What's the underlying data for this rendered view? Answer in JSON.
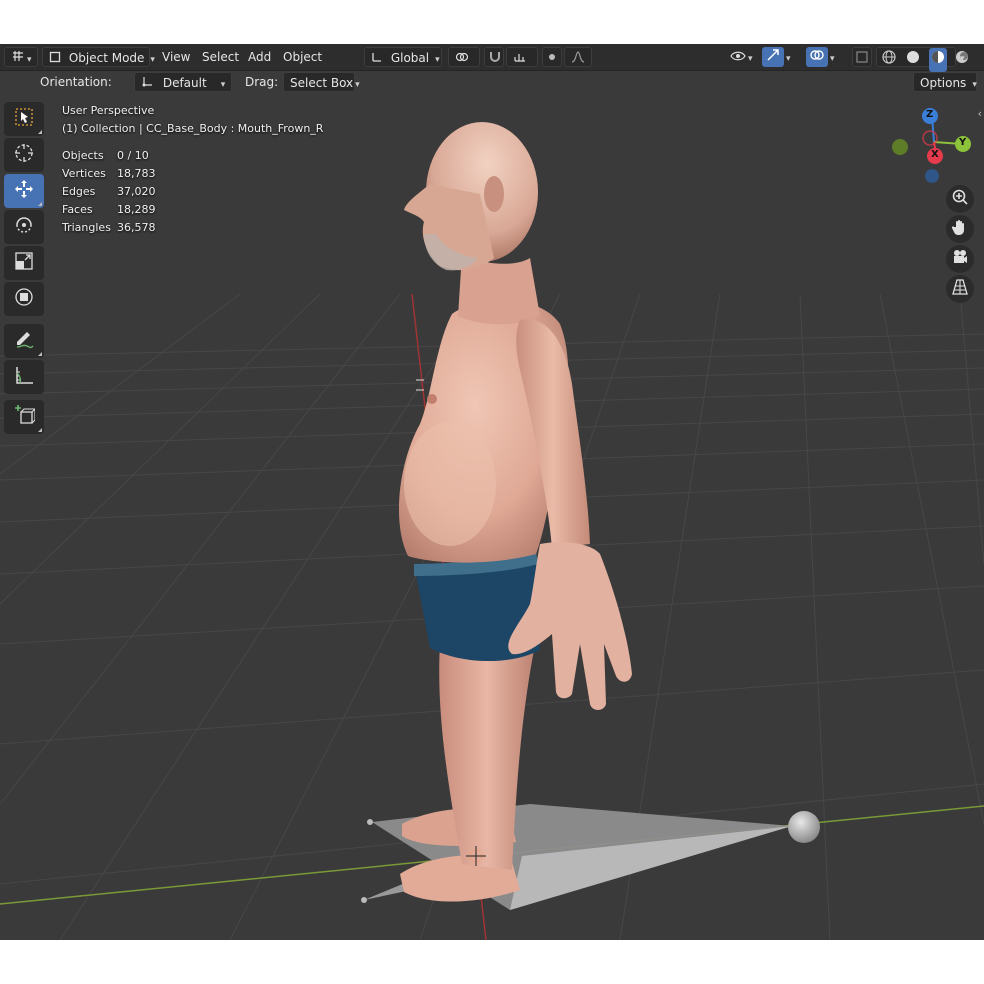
{
  "header": {
    "editor_type_icon": "grid-pencil-icon",
    "mode_label": "Object Mode",
    "menus": [
      "View",
      "Select",
      "Add",
      "Object"
    ],
    "transform_orientation": "Global",
    "pivot_icon": "pivot-link-icon",
    "snap_icon": "magnet-icon",
    "proportional_icon": "proportional-falloff-icon",
    "visibility_icon": "eye-icon",
    "gizmo_icon": "gizmo-arrow-icon",
    "overlay_icon": "overlay-circles-icon",
    "xray_icon": "xray-square-icon",
    "shading_modes": [
      "wireframe",
      "solid",
      "material-preview",
      "rendered"
    ],
    "active_shading": "material-preview"
  },
  "subheader": {
    "orientation_label": "Orientation:",
    "orientation_value": "Default",
    "drag_label": "Drag:",
    "drag_value": "Select Box",
    "options_label": "Options"
  },
  "toolbar": {
    "tools": [
      {
        "name": "select-box",
        "icon": "select-box-icon",
        "active": false
      },
      {
        "name": "cursor",
        "icon": "cursor-icon",
        "active": false
      },
      {
        "name": "move",
        "icon": "move-icon",
        "active": true
      },
      {
        "name": "rotate",
        "icon": "rotate-icon",
        "active": false
      },
      {
        "name": "scale",
        "icon": "scale-icon",
        "active": false
      },
      {
        "name": "transform",
        "icon": "transform-icon",
        "active": false
      },
      {
        "name": "annotate",
        "icon": "annotate-icon",
        "active": false
      },
      {
        "name": "measure",
        "icon": "measure-icon",
        "active": false
      },
      {
        "name": "add-cube",
        "icon": "add-cube-icon",
        "active": false
      }
    ]
  },
  "overlay": {
    "view_name": "User Perspective",
    "collection_info": "(1) Collection | CC_Base_Body : Mouth_Frown_R",
    "stats": [
      {
        "label": "Objects",
        "value": "0 / 10"
      },
      {
        "label": "Vertices",
        "value": "18,783"
      },
      {
        "label": "Edges",
        "value": "37,020"
      },
      {
        "label": "Faces",
        "value": "18,289"
      },
      {
        "label": "Triangles",
        "value": "36,578"
      }
    ]
  },
  "gizmo": {
    "z_label": "Z",
    "y_label": "Y",
    "x_label": "X",
    "colors": {
      "x": "#e63a4d",
      "y": "#8cc33a",
      "z": "#3a7ed8"
    }
  },
  "nav_buttons": [
    {
      "name": "zoom",
      "icon": "zoom-icon"
    },
    {
      "name": "pan",
      "icon": "hand-icon"
    },
    {
      "name": "camera",
      "icon": "camera-icon"
    },
    {
      "name": "perspective",
      "icon": "grid-perspective-icon"
    }
  ],
  "colors": {
    "viewport_bg": "#3a3a3a",
    "header_bg": "#2d2d2d",
    "active_blue": "#4772b3",
    "skin": "#e3b09c",
    "shorts": "#1c4566"
  }
}
